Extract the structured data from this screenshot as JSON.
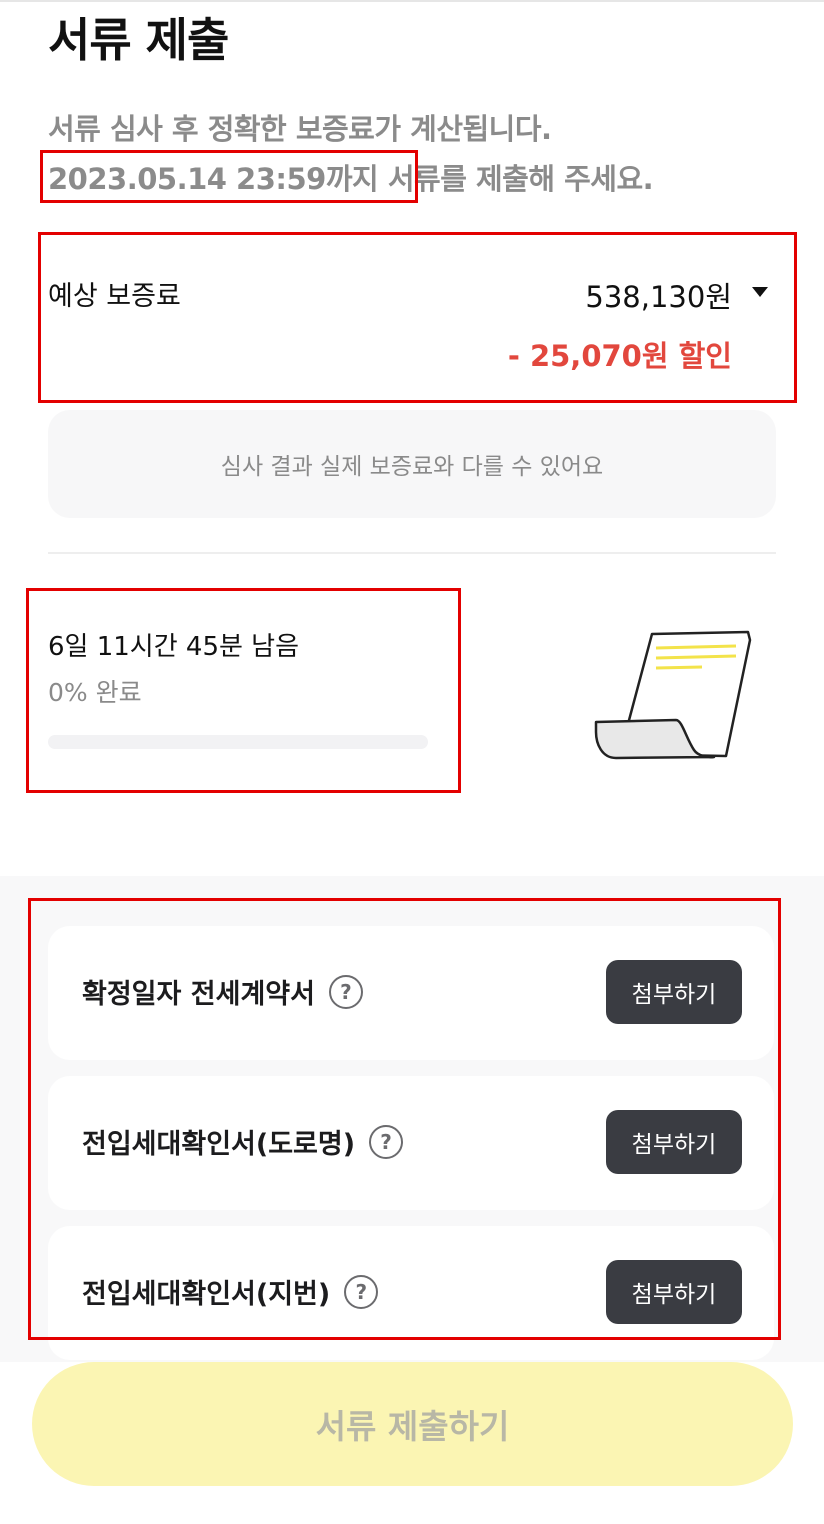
{
  "header": {
    "title": "서류 제출"
  },
  "intro": {
    "line1": "서류 심사 후 정확한 보증료가 계산됩니다.",
    "deadline": "2023.05.14 23:59까지",
    "line2_suffix": " 서류를 제출해 주세요."
  },
  "fee": {
    "label": "예상 보증료",
    "amount": "538,130원",
    "discount": "- 25,070원 할인",
    "notice": "심사 결과 실제 보증료와 다를 수 있어요"
  },
  "progress": {
    "remaining": "6일 11시간 45분 남음",
    "percent_label": "0% 완료",
    "percent_value": 0
  },
  "documents": [
    {
      "title": "확정일자 전세계약서",
      "button": "첨부하기"
    },
    {
      "title": "전입세대확인서(도로명)",
      "button": "첨부하기"
    },
    {
      "title": "전입세대확인서(지번)",
      "button": "첨부하기"
    }
  ],
  "help_icon_glyph": "?",
  "submit": {
    "label": "서류 제출하기"
  },
  "colors": {
    "discount": "#e2473d",
    "button_dark": "#3a3c42",
    "submit_bg": "#fbf5b3",
    "highlight": "#e30000"
  }
}
